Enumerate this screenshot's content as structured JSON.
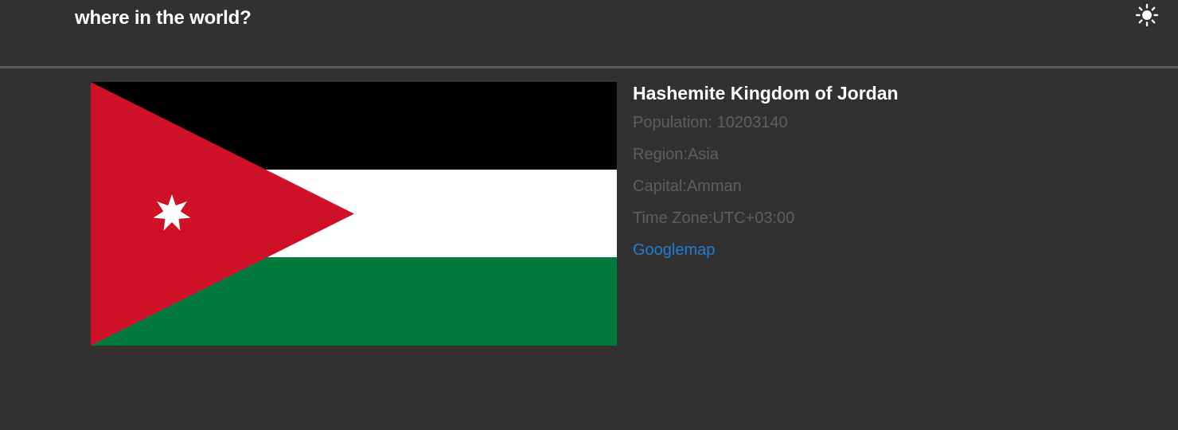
{
  "header": {
    "title": "where in the world?",
    "theme_icon": "sun-icon"
  },
  "country": {
    "name": "Hashemite Kingdom of Jordan",
    "population_label": "Population: ",
    "population": "10203140",
    "region_label": "Region:",
    "region": "Asia",
    "capital_label": "Capital:",
    "capital": "Amman",
    "timezone_label": "Time Zone:",
    "timezone": "UTC+03:00",
    "map_link": "Googlemap"
  },
  "colors": {
    "background": "#323031",
    "divider": "#5a5859",
    "muted_text": "#5f5e5f",
    "link": "#1e7fd4",
    "flag_black": "#000000",
    "flag_white": "#ffffff",
    "flag_green": "#007a3d",
    "flag_red": "#ce1126"
  }
}
